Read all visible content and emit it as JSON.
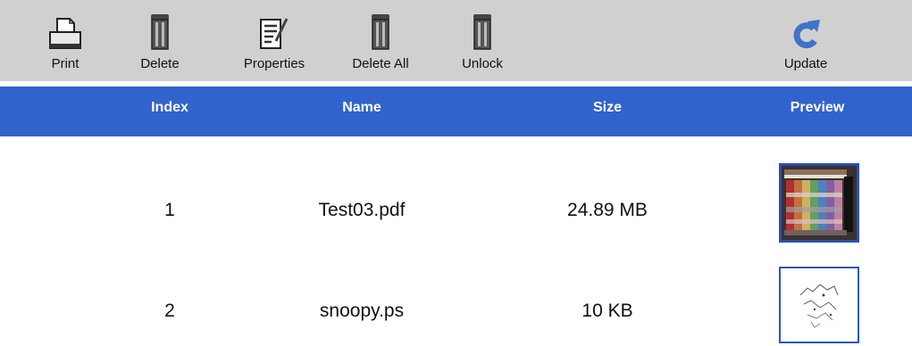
{
  "toolbar": {
    "print_label": "Print",
    "delete_label": "Delete",
    "properties_label": "Properties",
    "delete_all_label": "Delete All",
    "unlock_label": "Unlock",
    "update_label": "Update"
  },
  "table": {
    "columns": [
      "Index",
      "Name",
      "Size",
      "Preview"
    ],
    "rows": [
      {
        "index": "1",
        "name": "Test03.pdf",
        "size": "24.89 MB",
        "preview_icon": "color-chart-thumbnail",
        "preview_border": "#2b4fb0"
      },
      {
        "index": "2",
        "name": "snoopy.ps",
        "size": "10 KB",
        "preview_icon": "line-drawing-thumbnail",
        "preview_border": "#2f55c0"
      }
    ]
  },
  "colors": {
    "toolbar_bg": "#d0d0d0",
    "header_bg": "#3262cc",
    "update_icon": "#3f73c9"
  }
}
